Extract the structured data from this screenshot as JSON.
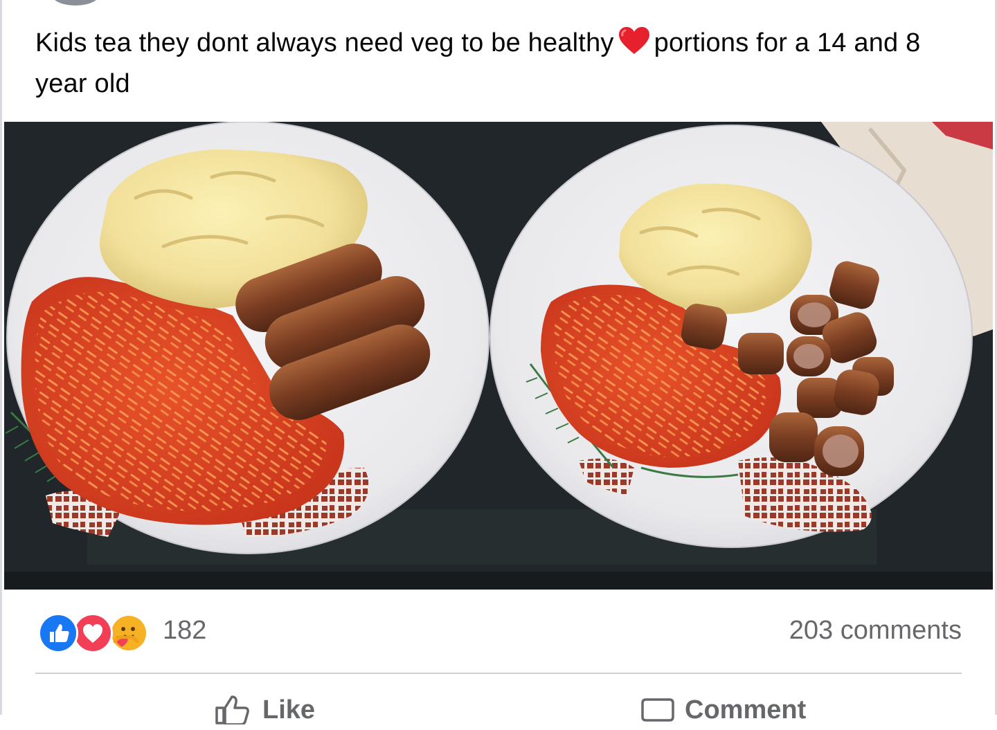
{
  "post": {
    "text_part1": "Kids tea they dont always need veg to be healthy",
    "text_part2": "portions for a 14 and 8 year old",
    "emoji": "red-heart-icon"
  },
  "photo": {
    "subject": "food-photo"
  },
  "stats": {
    "reactions": [
      "like-icon",
      "love-icon",
      "care-icon"
    ],
    "reaction_count": "182",
    "comment_count": "203 comments"
  },
  "actions": {
    "like_label": "Like",
    "comment_label": "Comment"
  },
  "colors": {
    "like_blue": "#1877f2",
    "love_red": "#f33e58",
    "care_yellow": "#f7b125",
    "secondary_text": "#65676b"
  }
}
